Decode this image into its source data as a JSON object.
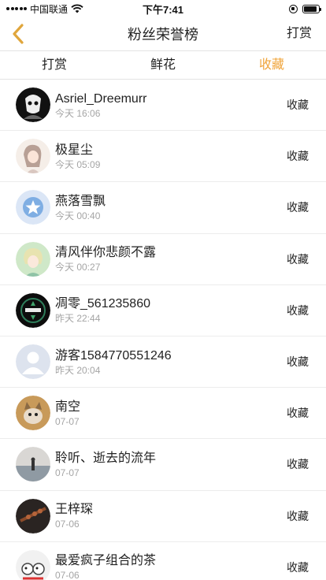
{
  "status_bar": {
    "carrier": "中国联通",
    "time": "下午7:41",
    "battery_level": 0.9
  },
  "nav": {
    "title": "粉丝荣誉榜",
    "action_label": "打赏",
    "back_icon": "chevron-left-icon",
    "accent_color": "#f0a43a"
  },
  "tabs": [
    {
      "label": "打赏",
      "active": false
    },
    {
      "label": "鲜花",
      "active": false
    },
    {
      "label": "收藏",
      "active": true
    }
  ],
  "list": [
    {
      "name": "Asriel_Dreemurr",
      "time": "今天 16:06",
      "action": "收藏",
      "avatar": "dark-character-avatar"
    },
    {
      "name": "极星尘",
      "time": "今天 05:09",
      "action": "收藏",
      "avatar": "anime-girl-avatar"
    },
    {
      "name": "燕落雪飘",
      "time": "今天 00:40",
      "action": "收藏",
      "avatar": "star-logo-avatar"
    },
    {
      "name": "清风伴你悲颜不露",
      "time": "今天 00:27",
      "action": "收藏",
      "avatar": "anime-boy-avatar"
    },
    {
      "name": "凋零_561235860",
      "time": "昨天 22:44",
      "action": "收藏",
      "avatar": "game-emblem-avatar"
    },
    {
      "name": "游客1584770551246",
      "time": "昨天 20:04",
      "action": "收藏",
      "avatar": "default-user-avatar"
    },
    {
      "name": "南空",
      "time": "07-07",
      "action": "收藏",
      "avatar": "cat-photo-avatar"
    },
    {
      "name": "聆听、逝去的流年",
      "time": "07-07",
      "action": "收藏",
      "avatar": "sea-scene-avatar"
    },
    {
      "name": "王梓琛",
      "time": "07-06",
      "action": "收藏",
      "avatar": "dark-photo-avatar"
    },
    {
      "name": "最爱疯子组合的茶",
      "time": "07-06",
      "action": "收藏",
      "avatar": "cartoon-pair-avatar"
    }
  ]
}
